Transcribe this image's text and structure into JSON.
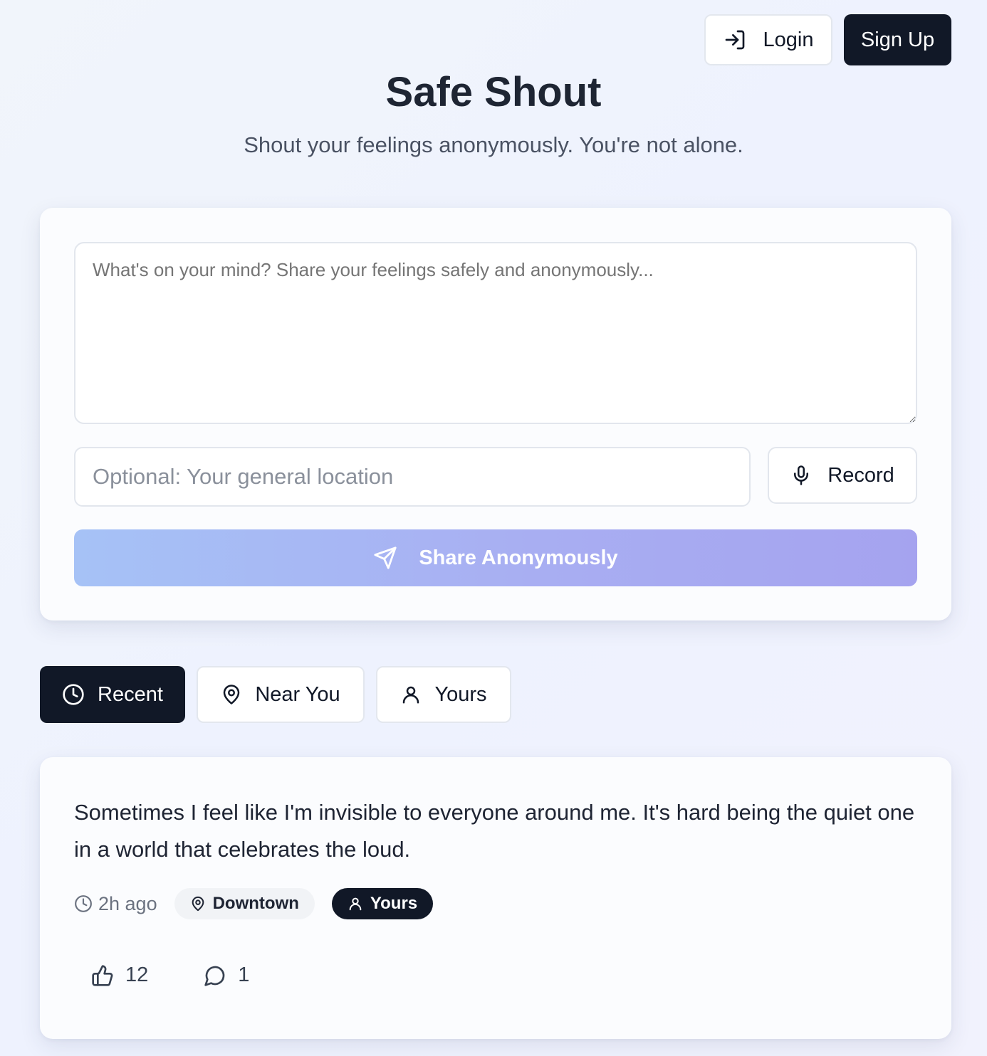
{
  "header": {
    "login_label": "Login",
    "signup_label": "Sign Up",
    "title": "Safe Shout",
    "subtitle": "Shout your feelings anonymously. You're not alone."
  },
  "composer": {
    "message_placeholder": "What's on your mind? Share your feelings safely and anonymously...",
    "message_value": "",
    "location_placeholder": "Optional: Your general location",
    "location_value": "",
    "record_label": "Record",
    "share_label": "Share Anonymously"
  },
  "tabs": [
    {
      "label": "Recent",
      "icon": "clock-icon",
      "active": true
    },
    {
      "label": "Near You",
      "icon": "map-pin-icon",
      "active": false
    },
    {
      "label": "Yours",
      "icon": "user-icon",
      "active": false
    }
  ],
  "posts": [
    {
      "text": "Sometimes I feel like I'm invisible to everyone around me. It's hard being the quiet one in a world that celebrates the loud.",
      "time": "2h ago",
      "location": "Downtown",
      "owner_badge": "Yours",
      "likes": "12",
      "comments": "1"
    }
  ],
  "colors": {
    "primary_dark": "#111827",
    "share_gradient_start": "#a6c2f6",
    "share_gradient_end": "#a5a3ef",
    "background": "#eef2fe"
  }
}
